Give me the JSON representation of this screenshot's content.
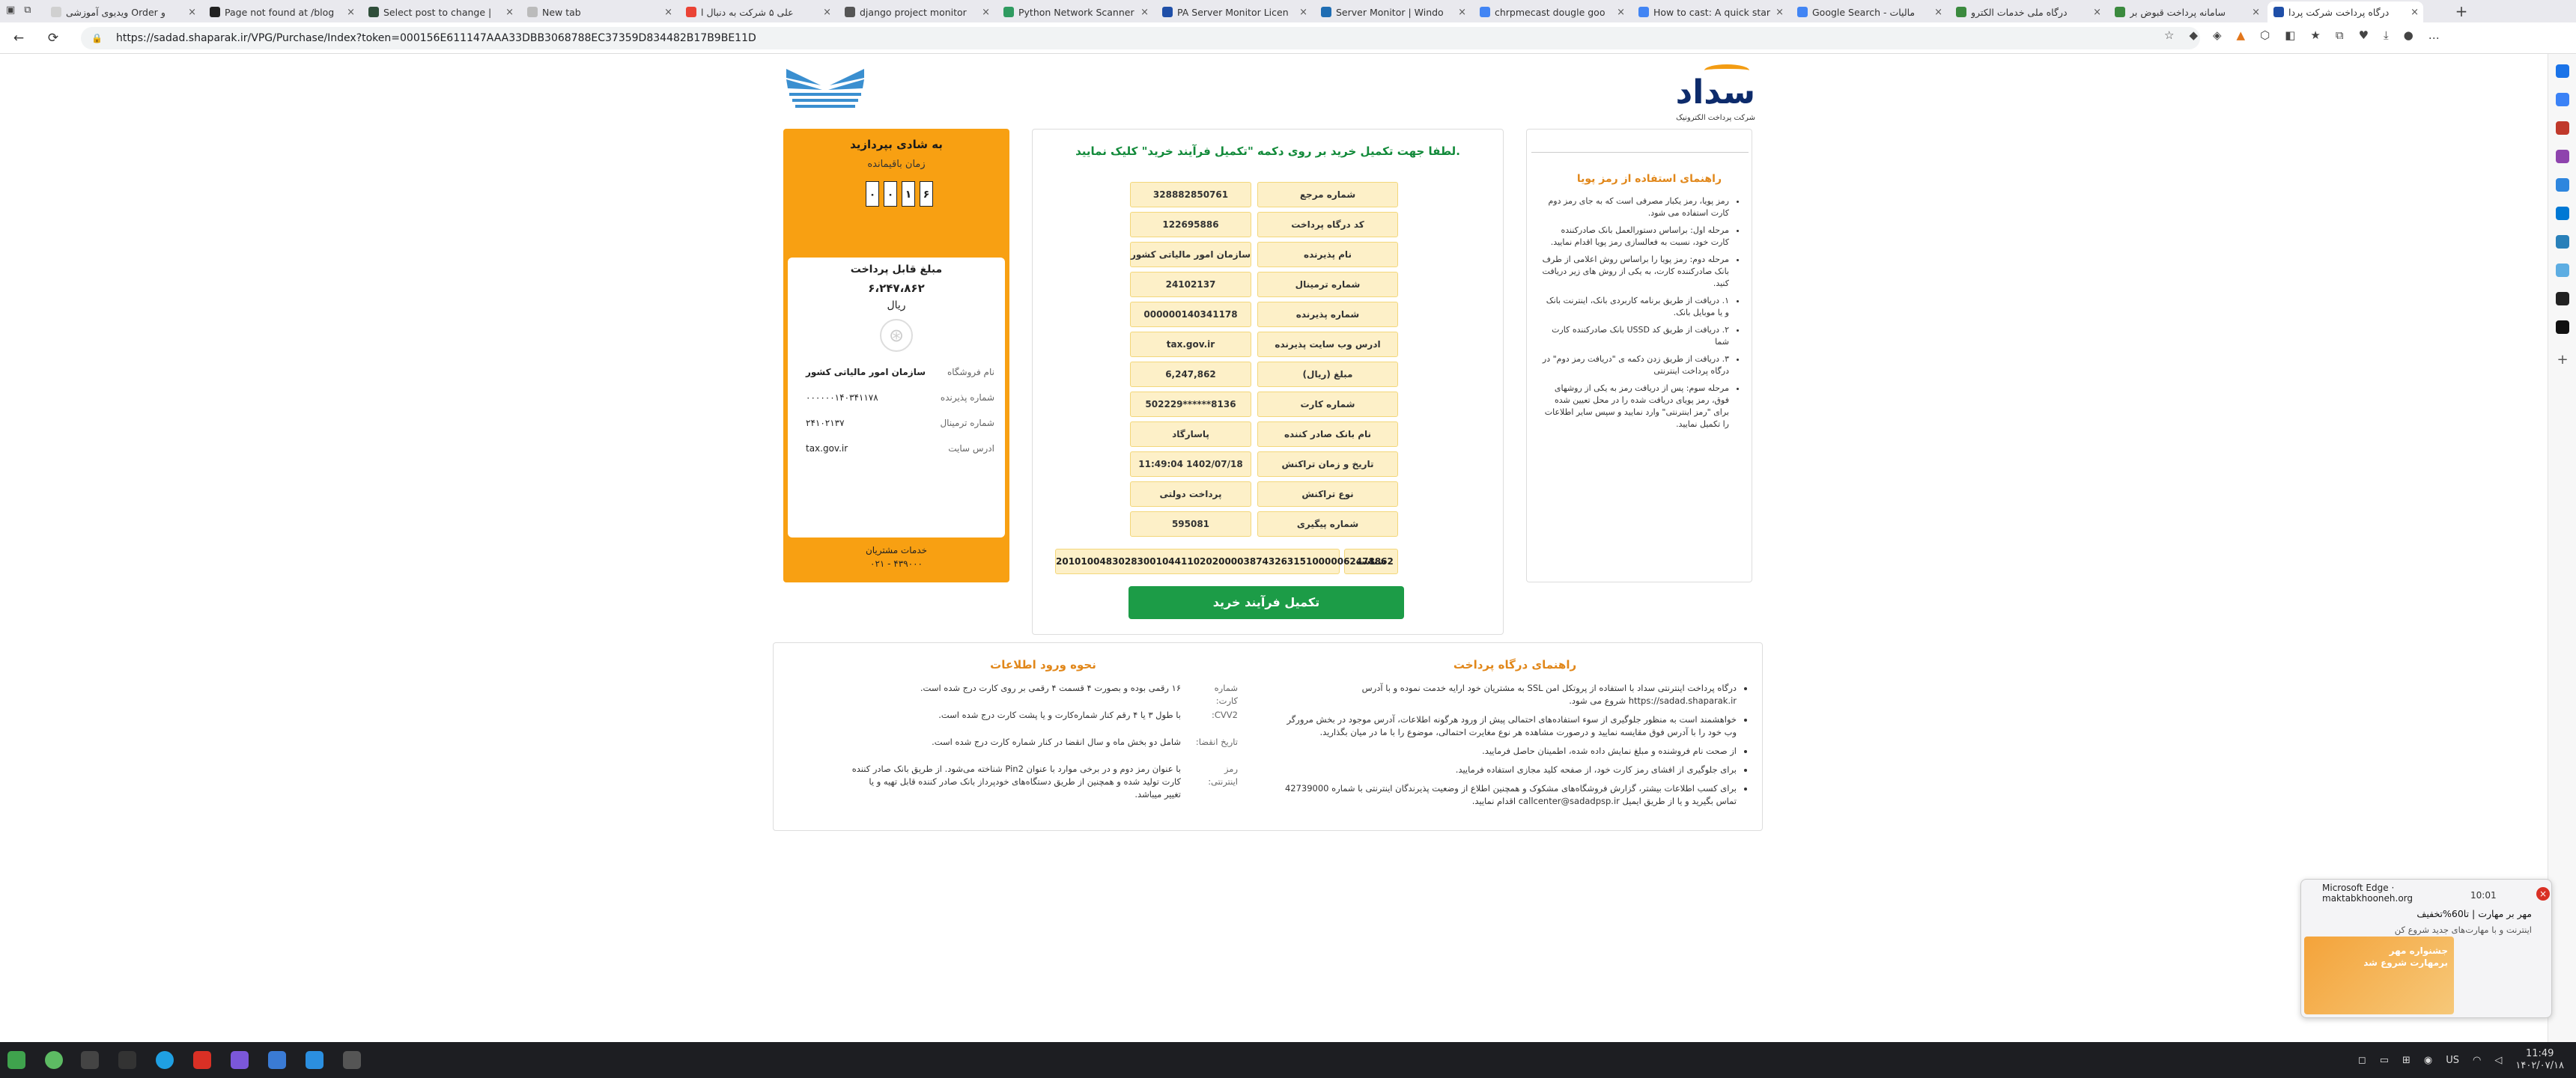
{
  "browser": {
    "tabs": [
      {
        "title": "ویدیوی آموزشی Order و",
        "color": "#d0d0d0"
      },
      {
        "title": "Page not found at /blog",
        "color": "#222"
      },
      {
        "title": "Select post to change |",
        "color": "#2f4e3a"
      },
      {
        "title": "New tab",
        "color": "#bbb"
      },
      {
        "title": "علی ۵ شرکت به دنبال ا",
        "color": "#ea4335"
      },
      {
        "title": "django project monitor",
        "color": "#555"
      },
      {
        "title": "Python Network Scanner",
        "color": "#2f9b60"
      },
      {
        "title": "PA Server Monitor Licen",
        "color": "#1f4fa8"
      },
      {
        "title": "Server Monitor | Windo",
        "color": "#1f6db3"
      },
      {
        "title": "chrpmecast dougle goo",
        "color": "#4285f4"
      },
      {
        "title": "How to cast: A quick star",
        "color": "#4285f4"
      },
      {
        "title": "Google Search - مالیات",
        "color": "#4285f4"
      },
      {
        "title": "درگاه ملی خدمات الکترو",
        "color": "#3b8a3e"
      },
      {
        "title": "سامانه پرداخت قبوض بر",
        "color": "#3b8a3e"
      },
      {
        "title": "درگاه پرداخت شرکت پردا",
        "color": "#1f4fa8"
      }
    ],
    "url": "https://sadad.shaparak.ir/VPG/Purchase/Index?token=000156E611147AAA33DBB3068788EC37359D834482B17B9BE11D"
  },
  "brand": {
    "sadad_word": "سداد",
    "sadad_sub": "شرکت پرداخت الکترونیک",
    "bank_caption": "بانک ملی"
  },
  "summary": {
    "heading": "به شادی بپردازید",
    "remaining_label": "زمان باقیمانده",
    "timer": [
      "۰",
      "۰",
      "۱",
      "۶"
    ],
    "amount_label": "مبلغ قابل پرداخت",
    "amount": "۶،۲۴۷،۸۶۲",
    "currency": "ریال",
    "rows": [
      {
        "key": "نام فروشگاه",
        "value": "سازمان امور مالیاتی کشور"
      },
      {
        "key": "شماره پذیرنده",
        "value": "۰۰۰۰۰۰۱۴۰۳۴۱۱۷۸"
      },
      {
        "key": "شماره ترمینال",
        "value": "۲۴۱۰۲۱۳۷"
      },
      {
        "key": "ادرس سایت",
        "value": "tax.gov.ir"
      }
    ],
    "support_label": "خدمات مشتریان",
    "support_number": "۰۲۱ - ۴۳۹۰۰۰"
  },
  "form": {
    "heading": "لطفا جهت تکمیل خرید بر روی دکمه \"تکمیل فرآیند خرید\" کلیک نمایید.",
    "rows": [
      {
        "key": "شماره مرجع",
        "value": "328882850761"
      },
      {
        "key": "کد درگاه پرداخت",
        "value": "122695886"
      },
      {
        "key": "نام پذیرنده",
        "value": "سازمان امور مالیاتی کشور"
      },
      {
        "key": "شماره ترمینال",
        "value": "24102137"
      },
      {
        "key": "شماره پذیرنده",
        "value": "000000140341178"
      },
      {
        "key": "ادرس وب سایت پذیرنده",
        "value": "tax.gov.ir"
      },
      {
        "key": "مبلغ (ریال)",
        "value": "6,247,862"
      },
      {
        "key": "شماره کارت",
        "value": "502229******8136"
      },
      {
        "key": "نام بانک صادر کننده",
        "value": "پاسارگاد"
      },
      {
        "key": "تاریخ و زمان تراکنش",
        "value": "11:49:04 1402/07/18"
      },
      {
        "key": "نوع تراکنش",
        "value": "پرداخت دولتی"
      },
      {
        "key": "شماره پیگیری",
        "value": "595081"
      }
    ],
    "shaba_key": "شناسه",
    "shaba_value": "201010048302830010441102020000387432631510000062478862",
    "finish_button": "تکمیل فرآیند خرید"
  },
  "guide": {
    "heading": "راهنمای استفاده از رمز پویا",
    "items": [
      "رمز پویا، رمز یکبار مصرفی است که به جای رمز دوم کارت استفاده می شود.",
      "مرحله اول: براساس دستورالعمل بانک صادرکننده کارت خود، نسبت به فعالسازی رمز پویا اقدام نمایید.",
      "مرحله دوم: رمز پویا را براساس روش اعلامی از طرف بانک صادرکننده کارت، به یکی از روش های زیر دریافت کنید.",
      "۱. دریافت از طریق برنامه کاربردی بانک، اینترنت بانک و یا موبایل بانک.",
      "۲. دریافت از طریق کد USSD بانک صادرکننده کارت شما",
      "۳. دریافت از طریق زدن دکمه ی \"دریافت رمز دوم\" در درگاه پرداخت اینترنتی",
      "مرحله سوم: پس از دریافت رمز به یکی از روشهای فوق، رمز پویای دریافت شده را در محل تعیین شده برای \"رمز اینترنتی\" وارد نمایید و سپس سایر اطلاعات را تکمیل نمایید."
    ]
  },
  "bottom": {
    "right_heading": "راهنمای درگاه پرداخت",
    "right_items": [
      "درگاه پرداخت اینترنتی سداد با استفاده از پروتکل امن SSL به مشتریان خود ارایه خدمت نموده و با آدرس https://sadad.shaparak.ir شروع می شود.",
      "خواهشمند است به منظور جلوگیری از سوء استفاده‌های احتمالی پیش از ورود هرگونه اطلاعات، آدرس موجود در بخش مرورگر وب خود را با آدرس فوق مقایسه نمایید و درصورت مشاهده هر نوع مغایرت احتمالی، موضوع را با ما در میان بگذارید.",
      "از صحت نام فروشنده و مبلغ نمایش داده شده، اطمینان حاصل فرمایید.",
      "برای جلوگیری از افشای رمز کارت خود، از صفحه کلید مجازی استفاده فرمایید.",
      "برای کسب اطلاعات بیشتر، گزارش فروشگاه‌های مشکوک و همچنین اطلاع از وضعیت پذیرندگان اینترنتی با شماره 42739000 تماس بگیرید و یا از طریق ایمیل callcenter@sadadpsp.ir اقدام نمایید."
    ],
    "left_heading": "نحوه ورود اطلاعات",
    "left_rows": [
      {
        "key": "شماره کارت:",
        "value": "۱۶ رقمی بوده و بصورت ۴ قسمت ۴ رقمی بر روی کارت درج شده است."
      },
      {
        "key": "CVV2:",
        "value": "با طول ۳ یا ۴ رقم کنار شماره‌کارت و یا پشت کارت درج شده است."
      },
      {
        "key": "تاریخ انقضا:",
        "value": "شامل دو بخش ماه و سال انقضا در کنار شماره کارت درج شده است."
      },
      {
        "key": "رمز اینترنتی:",
        "value": "با عنوان رمز دوم و در برخی موارد با عنوان Pin2 شناخته می‌شود. از طریق بانک صادر کننده کارت تولید شده و همچنین از طریق دستگاه‌های خودپرداز بانک صادر کننده قابل تهیه و یا تغییر میباشد."
      }
    ]
  },
  "popup": {
    "source": "Microsoft Edge · maktabkhooneh.org",
    "time": "10:01",
    "message": "مهر بر مهارت | تا60%تخفیف",
    "sub": "اینترنت و با مهارت‌های جدید شروع کن",
    "banner_line1": "جشنواره مهر",
    "banner_line2": "برمهارت شروع شد"
  },
  "taskbar": {
    "lang": "US",
    "time": "11:49",
    "date": "۱۴۰۲/۰۷/۱۸"
  }
}
